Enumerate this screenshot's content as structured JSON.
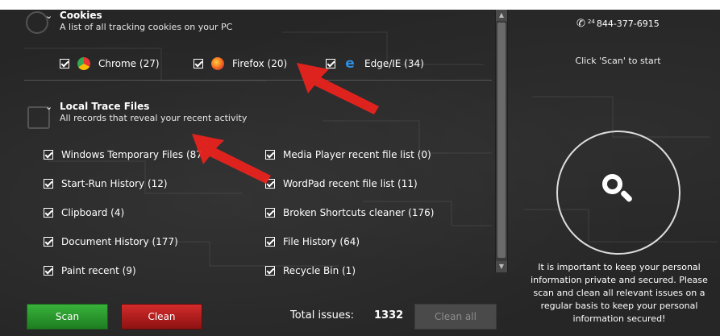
{
  "cookies": {
    "title": "Cookies",
    "subtitle": "A list of all tracking cookies on your PC",
    "browsers": [
      {
        "label": "Chrome (27)",
        "icon": "chrome-icon"
      },
      {
        "label": "Firefox (20)",
        "icon": "firefox-icon"
      },
      {
        "label": "Edge/IE (34)",
        "icon": "edge-icon"
      }
    ]
  },
  "trace": {
    "title": "Local Trace Files",
    "subtitle": "All records that reveal your recent activity",
    "items_left": [
      "Windows Temporary Files (87",
      "Start-Run History (12)",
      "Clipboard (4)",
      "Document History (177)",
      "Paint recent (9)"
    ],
    "items_right": [
      "Media Player recent file list (0)",
      "WordPad recent file list (11)",
      "Broken Shortcuts cleaner (176)",
      "File History (64)",
      "Recycle Bin (1)"
    ]
  },
  "right": {
    "phone_prefix": "24",
    "phone": "844-377-6915",
    "scan_hint": "Click 'Scan' to start",
    "info": "It is important to keep your personal information private and secured. Please scan and clean all relevant issues on a regular basis to keep your personal information secured!"
  },
  "bottom": {
    "scan_label": "Scan",
    "clean_label": "Clean",
    "total_label": "Total issues:",
    "total_value": "1332",
    "clean_all_label": "Clean all"
  },
  "colors": {
    "scan_green": "#2e9e30",
    "clean_red": "#c62020",
    "arrow_red": "#e8231f"
  }
}
